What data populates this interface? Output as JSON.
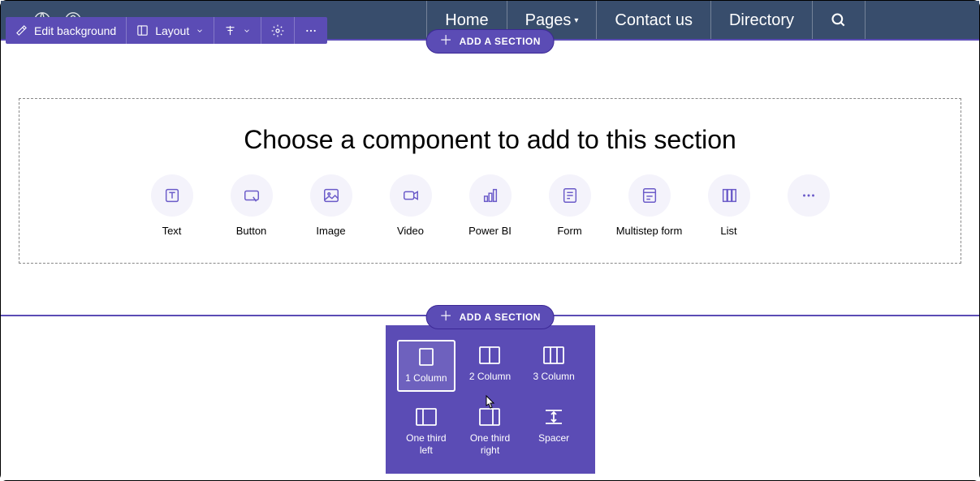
{
  "topNav": {
    "items": [
      "Home",
      "Pages",
      "Contact us",
      "Directory"
    ]
  },
  "toolbar": {
    "editBackground": "Edit background",
    "layout": "Layout"
  },
  "addSection": "ADD A SECTION",
  "section": {
    "title": "Choose a component to add to this section",
    "components": [
      {
        "id": "text",
        "label": "Text"
      },
      {
        "id": "button",
        "label": "Button"
      },
      {
        "id": "image",
        "label": "Image"
      },
      {
        "id": "video",
        "label": "Video"
      },
      {
        "id": "powerbi",
        "label": "Power BI"
      },
      {
        "id": "form",
        "label": "Form"
      },
      {
        "id": "multistep",
        "label": "Multistep form"
      },
      {
        "id": "list",
        "label": "List"
      },
      {
        "id": "more",
        "label": ""
      }
    ]
  },
  "layoutPopover": {
    "options": [
      {
        "id": "1col",
        "label": "1 Column",
        "selected": true
      },
      {
        "id": "2col",
        "label": "2 Column"
      },
      {
        "id": "3col",
        "label": "3 Column"
      },
      {
        "id": "thirdleft",
        "label": "One third left"
      },
      {
        "id": "thirdright",
        "label": "One third right"
      },
      {
        "id": "spacer",
        "label": "Spacer"
      }
    ]
  }
}
